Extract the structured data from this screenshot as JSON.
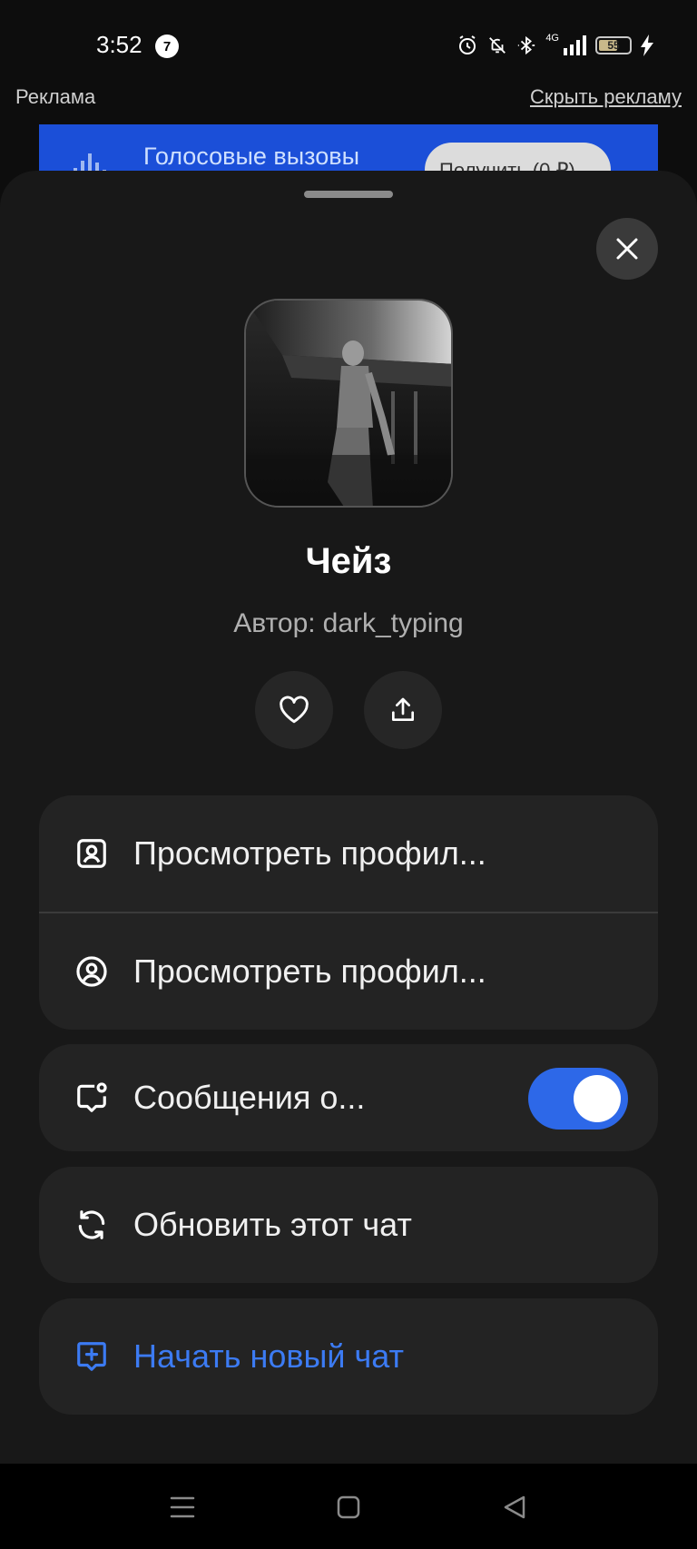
{
  "status_bar": {
    "time": "3:52",
    "notification_count": "7",
    "network_type": "4G",
    "battery_percent": "55",
    "icons": [
      "alarm-icon",
      "mute-icon",
      "bluetooth-icon",
      "signal-icon",
      "battery-icon",
      "charging-icon"
    ]
  },
  "ad": {
    "label": "Реклама",
    "hide_label": "Скрыть рекламу",
    "banner_text": "Голосовые вызовы",
    "banner_button": "Получить (0 ₽)"
  },
  "sheet": {
    "bot_name": "Чейз",
    "author_prefix": "Автор:",
    "author_handle": "dark_typing",
    "like_icon": "heart-icon",
    "share_icon": "share-icon",
    "menu": {
      "view_profile_bot": "Просмотреть профил...",
      "view_profile_author": "Просмотреть профил...",
      "messages_toggle": "Сообщения о...",
      "messages_toggle_on": true,
      "refresh_chat": "Обновить этот чат",
      "new_chat": "Начать новый чат"
    }
  },
  "colors": {
    "accent": "#2d68e8",
    "new_chat_text": "#3c7bf3",
    "sheet_bg": "#181818",
    "card_bg": "#232323"
  }
}
